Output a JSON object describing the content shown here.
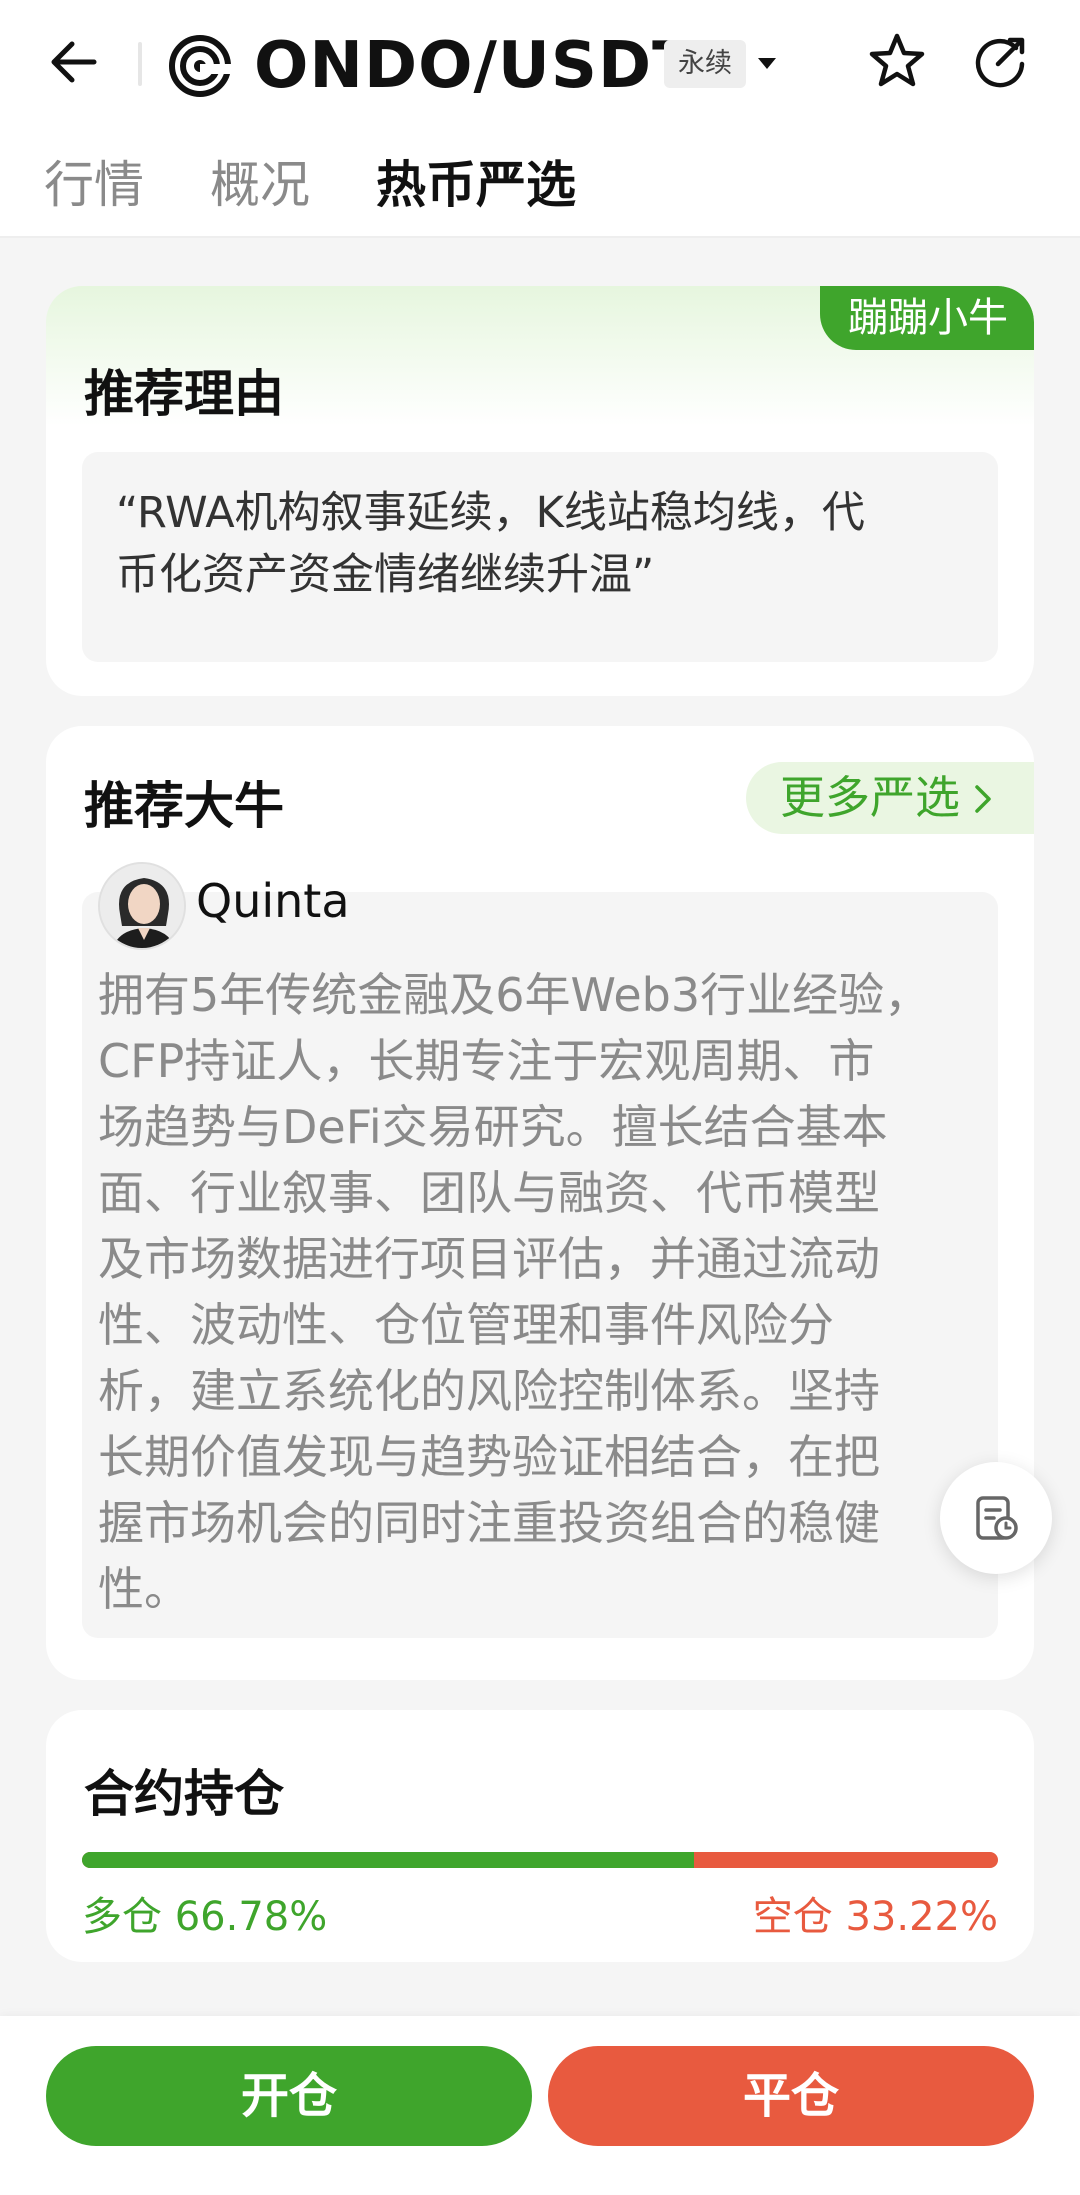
{
  "header": {
    "pair": "ONDO/USDT",
    "badge": "永续",
    "icons": [
      "back-arrow-icon",
      "ondo-logo-icon",
      "chevron-down-icon",
      "star-icon",
      "share-icon"
    ]
  },
  "tabs": [
    {
      "label": "行情",
      "active": false
    },
    {
      "label": "概况",
      "active": false
    },
    {
      "label": "热币严选",
      "active": true
    }
  ],
  "reason_card": {
    "tag": "蹦蹦小牛",
    "title": "推荐理由",
    "text_line1": "“RWA机构叙事延续，K线站稳均线，代",
    "text_line2": "币化资产资金情绪继续升温”"
  },
  "expert_card": {
    "title": "推荐大牛",
    "more_label": "更多严选",
    "author": "Quinta",
    "bio_lines": [
      "拥有5年传统金融及6年Web3行业经验，",
      "CFP持证人，长期专注于宏观周期、市",
      "场趋势与DeFi交易研究。擅长结合基本",
      "面、行业叙事、团队与融资、代币模型",
      "及市场数据进行项目评估，并通过流动",
      "性、波动性、仓位管理和事件风险分",
      "析，建立系统化的风险控制体系。坚持",
      "长期价值发现与趋势验证相结合，在把",
      "握市场机会的同时注重投资组合的稳健",
      "性。"
    ]
  },
  "position_card": {
    "title": "合约持仓",
    "long_label": "多仓 66.78%",
    "short_label": "空仓 33.22%",
    "long_percent": 66.78,
    "short_percent": 33.22,
    "long_color": "#3fa52c",
    "short_color": "#e85a3f"
  },
  "actions": {
    "open": "开仓",
    "close": "平仓"
  }
}
